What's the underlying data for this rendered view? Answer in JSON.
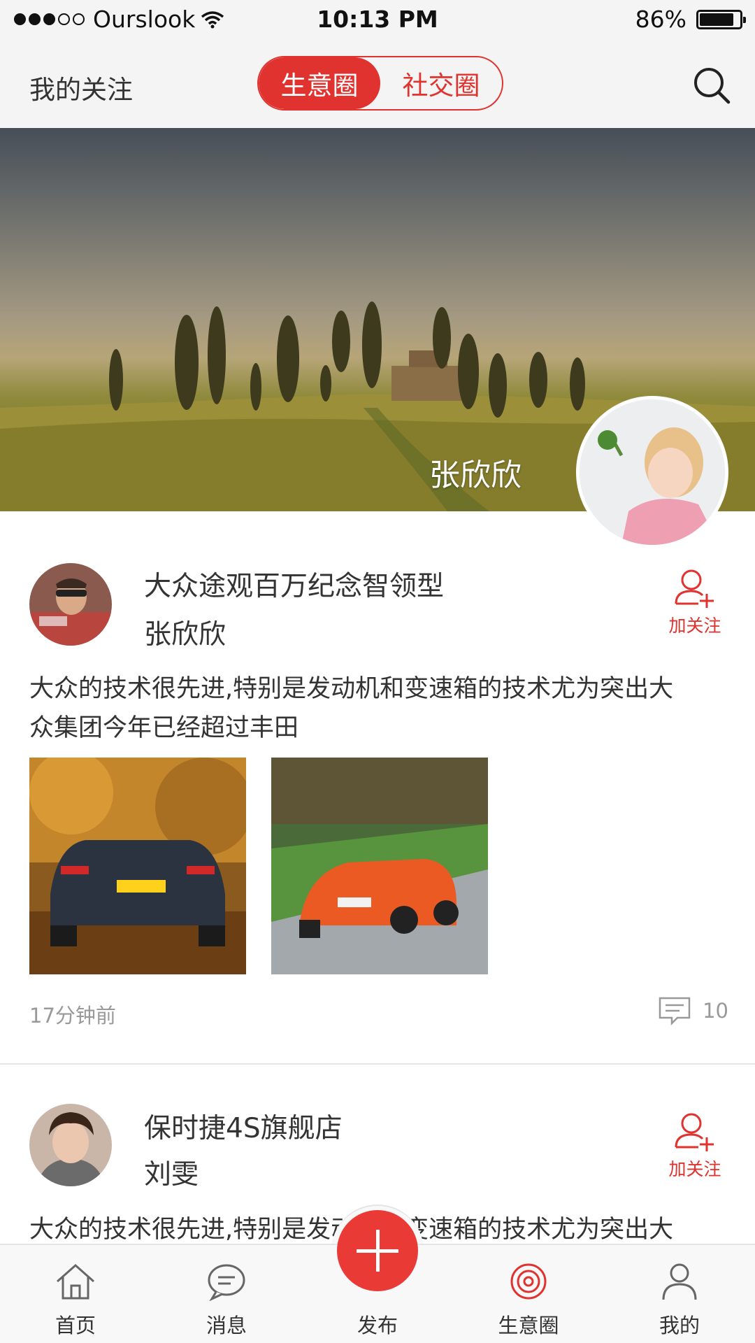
{
  "status_bar": {
    "carrier": "Ourslook",
    "time": "10:13 PM",
    "battery_percent": "86%",
    "battery_level": 0.86
  },
  "nav": {
    "left_label": "我的关注",
    "segments": [
      {
        "label": "生意圈",
        "active": true
      },
      {
        "label": "社交圈",
        "active": false
      }
    ],
    "search_icon": "search-icon"
  },
  "banner": {
    "profile_name": "张欣欣"
  },
  "posts": [
    {
      "title": "大众途观百万纪念智领型",
      "author": "张欣欣",
      "follow_label": "加关注",
      "text_line1": "大众的技术很先进,特别是发动机和变速箱的技术尤为突出大",
      "text_line2": "众集团今年已经超过丰田",
      "photos": [
        "black-convertible-autumn-road",
        "orange-convertible-mountain-road"
      ],
      "time": "17分钟前",
      "comment_count": "10"
    },
    {
      "title": "保时捷4S旗舰店",
      "author": "刘雯",
      "follow_label": "加关注",
      "text_line1": "大众的技术很先进,特别是发动机和变速箱的技术尤为突出大"
    }
  ],
  "tabs": [
    {
      "label": "首页",
      "icon": "home-icon"
    },
    {
      "label": "消息",
      "icon": "message-icon"
    },
    {
      "label": "发布",
      "icon": "plus-icon"
    },
    {
      "label": "生意圈",
      "icon": "circle-icon",
      "active": true
    },
    {
      "label": "我的",
      "icon": "user-icon"
    }
  ],
  "colors": {
    "accent": "#e0322e",
    "nav_bg": "#f4f4f4",
    "text": "#333333",
    "muted": "#999999"
  }
}
